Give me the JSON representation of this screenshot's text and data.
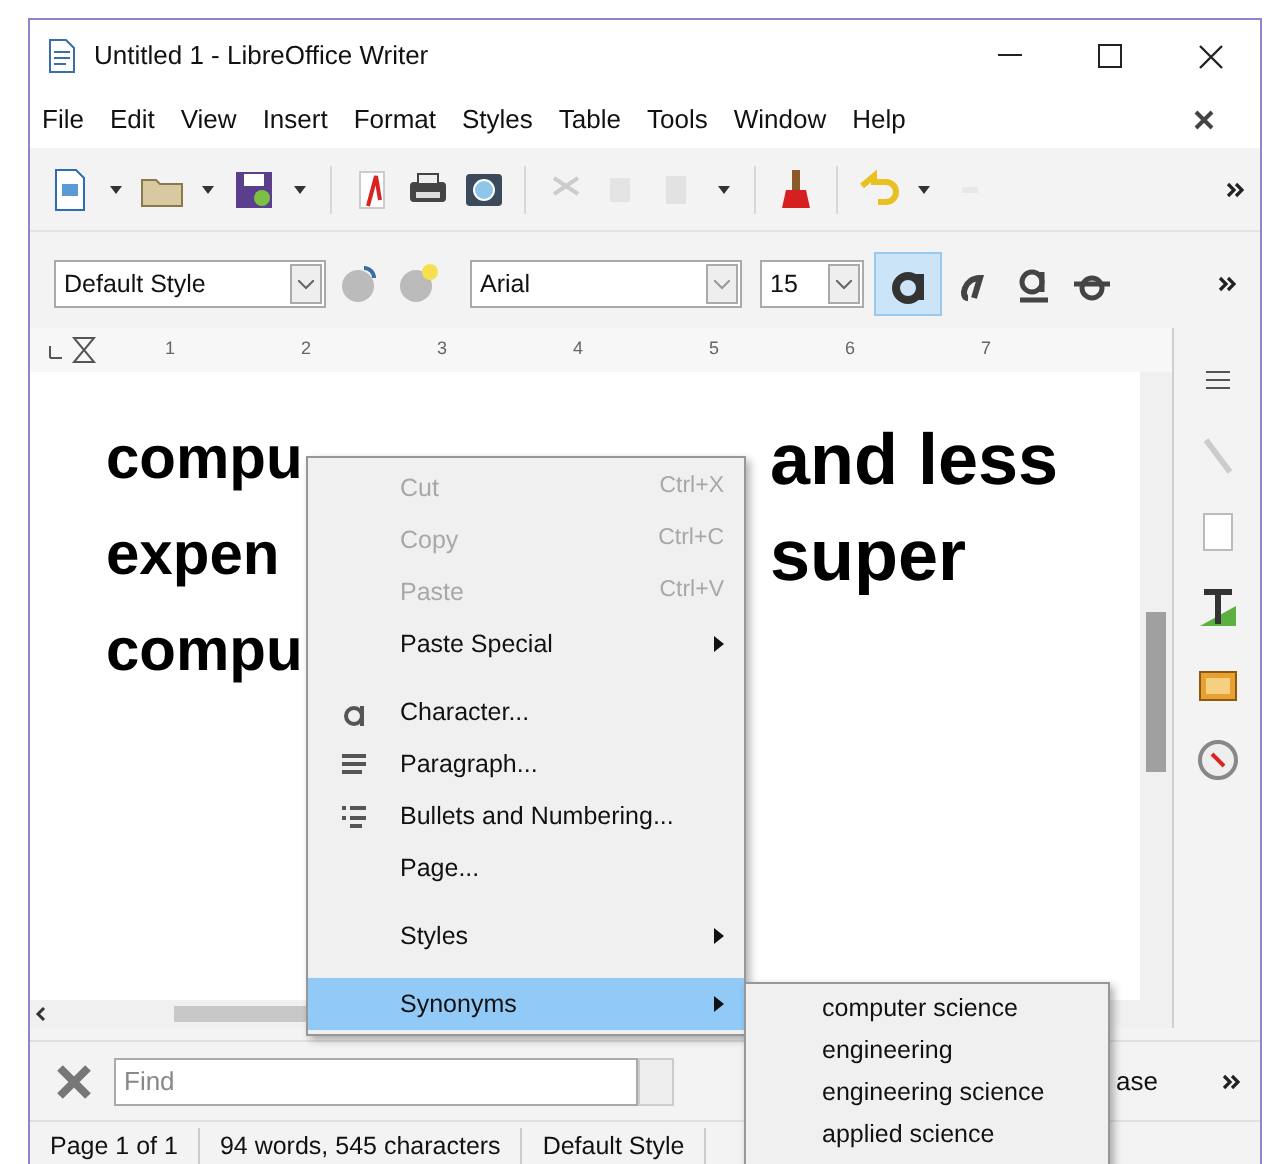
{
  "window": {
    "title": "Untitled 1 - LibreOffice Writer"
  },
  "menu_bar": [
    "File",
    "Edit",
    "View",
    "Insert",
    "Format",
    "Styles",
    "Table",
    "Tools",
    "Window",
    "Help"
  ],
  "formatting_bar": {
    "paragraph_style": "Default Style",
    "font_name": "Arial",
    "font_size": "15",
    "bold": true
  },
  "ruler": [
    "1",
    "2",
    "3",
    "4",
    "5",
    "6",
    "7"
  ],
  "document": {
    "lines": [
      [
        "compu",
        "and less"
      ],
      [
        "expen",
        "super"
      ],
      [
        "compu"
      ]
    ]
  },
  "context_menu": [
    {
      "kind": "command",
      "label": "Cut",
      "shortcut": "Ctrl+X",
      "disabled": true,
      "selected": false
    },
    {
      "kind": "command",
      "label": "Copy",
      "shortcut": "Ctrl+C",
      "disabled": true,
      "selected": false
    },
    {
      "kind": "command",
      "label": "Paste",
      "shortcut": "Ctrl+V",
      "disabled": true,
      "selected": false
    },
    {
      "kind": "submenu",
      "label": "Paste Special",
      "disabled": false,
      "selected": false
    },
    {
      "kind": "separator"
    },
    {
      "kind": "command",
      "label": "Character...",
      "disabled": false,
      "selected": false
    },
    {
      "kind": "command",
      "label": "Paragraph...",
      "disabled": false,
      "selected": false
    },
    {
      "kind": "command",
      "label": "Bullets and Numbering...",
      "disabled": false,
      "selected": false
    },
    {
      "kind": "command",
      "label": "Page...",
      "disabled": false,
      "selected": false
    },
    {
      "kind": "separator"
    },
    {
      "kind": "submenu",
      "label": "Styles",
      "disabled": false,
      "selected": false
    },
    {
      "kind": "separator"
    },
    {
      "kind": "submenu",
      "label": "Synonyms",
      "disabled": false,
      "selected": true
    }
  ],
  "synonyms_submenu": [
    "computer science",
    "engineering",
    "engineering science",
    "applied science"
  ],
  "find_bar": {
    "placeholder": "Find",
    "cut_label": "ase"
  },
  "status_bar": [
    "Page 1 of 1",
    "94 words, 545 characters",
    "Default Style"
  ]
}
